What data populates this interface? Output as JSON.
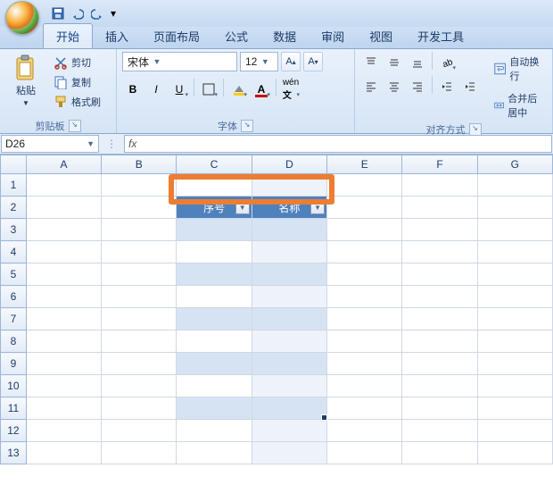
{
  "qat": {
    "save": "save",
    "undo": "undo",
    "redo": "redo"
  },
  "tabs": [
    "开始",
    "插入",
    "页面布局",
    "公式",
    "数据",
    "审阅",
    "视图",
    "开发工具"
  ],
  "active_tab": 0,
  "clipboard": {
    "paste": "粘贴",
    "cut": "剪切",
    "copy": "复制",
    "format_painter": "格式刷",
    "group_label": "剪贴板"
  },
  "font": {
    "name": "宋体",
    "size": "12",
    "group_label": "字体"
  },
  "alignment": {
    "wrap": "自动换行",
    "merge": "合并后居中",
    "group_label": "对齐方式"
  },
  "namebox": "D26",
  "formula": "",
  "columns": [
    "A",
    "B",
    "C",
    "D",
    "E",
    "F",
    "G"
  ],
  "rows": [
    1,
    2,
    3,
    4,
    5,
    6,
    7,
    8,
    9,
    10,
    11,
    12,
    13
  ],
  "table": {
    "header1": "序号",
    "header2": "名称",
    "header_row": 2,
    "data_rows": [
      3,
      4,
      5,
      6,
      7,
      8,
      9,
      10,
      11
    ],
    "cols": [
      "C",
      "D"
    ]
  },
  "chart_data": {
    "type": "table",
    "columns": [
      "序号",
      "名称"
    ],
    "rows": []
  },
  "colors": {
    "accent": "#4f81bd",
    "highlight": "#ed7d31",
    "grid": "#d0d7e5"
  }
}
